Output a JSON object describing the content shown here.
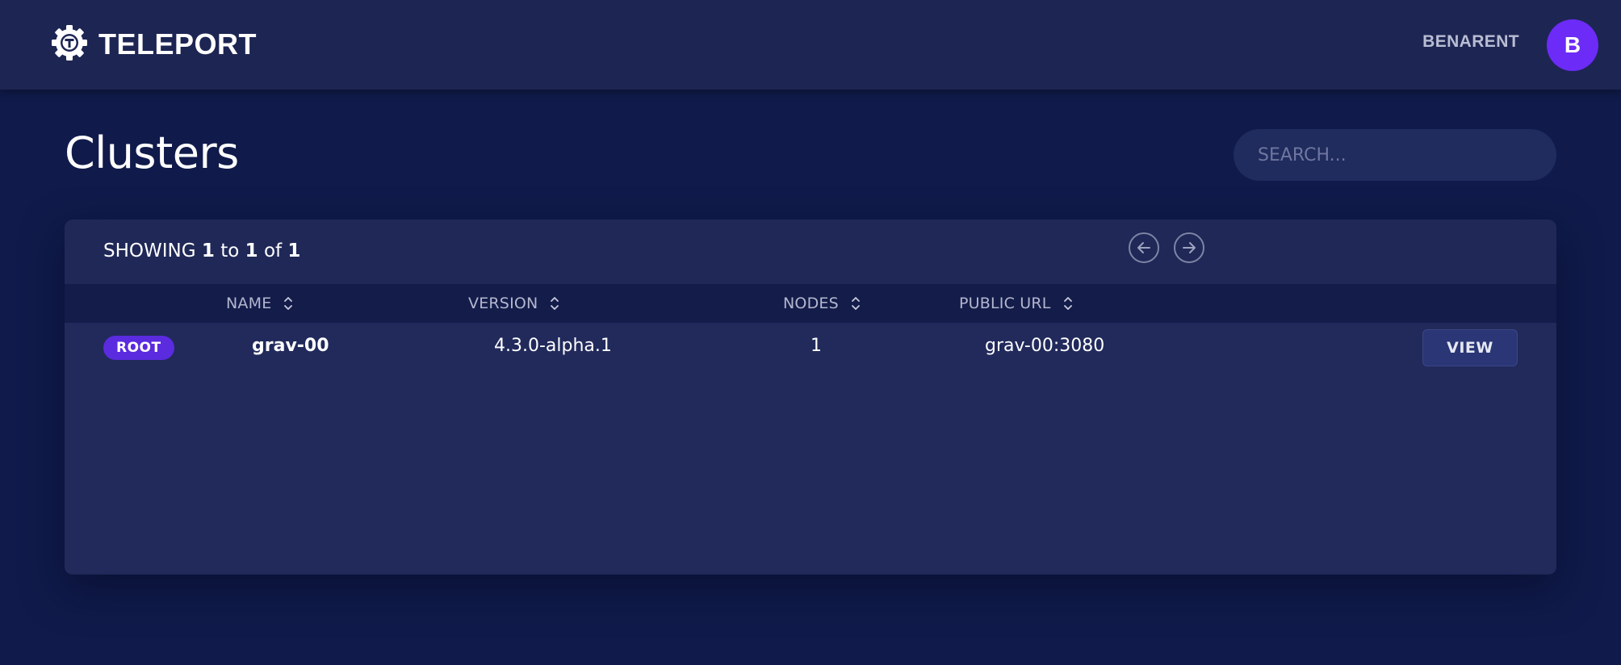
{
  "header": {
    "app_name": "TELEPORT",
    "logo_icon": "teleport-gear-icon",
    "username": "BENARENT",
    "avatar_initial": "B",
    "avatar_color": "#6c2bf6"
  },
  "page": {
    "title": "Clusters",
    "search_placeholder": "SEARCH..."
  },
  "table": {
    "showing_prefix": "SHOWING",
    "range_start": "1",
    "to_word": "to",
    "range_end": "1",
    "of_word": "of",
    "total": "1",
    "pager": {
      "prev_icon": "arrow-left-circle-icon",
      "next_icon": "arrow-right-circle-icon"
    },
    "columns": [
      {
        "label": "NAME",
        "sort_icon": "sort-icon"
      },
      {
        "label": "VERSION",
        "sort_icon": "sort-icon"
      },
      {
        "label": "NODES",
        "sort_icon": "sort-icon"
      },
      {
        "label": "PUBLIC URL",
        "sort_icon": "sort-icon"
      }
    ],
    "rows": [
      {
        "badge": "ROOT",
        "name": "grav-00",
        "version": "4.3.0-alpha.1",
        "nodes": "1",
        "public_url": "grav-00:3080",
        "action": "VIEW"
      }
    ]
  },
  "colors": {
    "background": "#101b4b",
    "card": "#1f2857",
    "accent": "#5b2bdf"
  }
}
